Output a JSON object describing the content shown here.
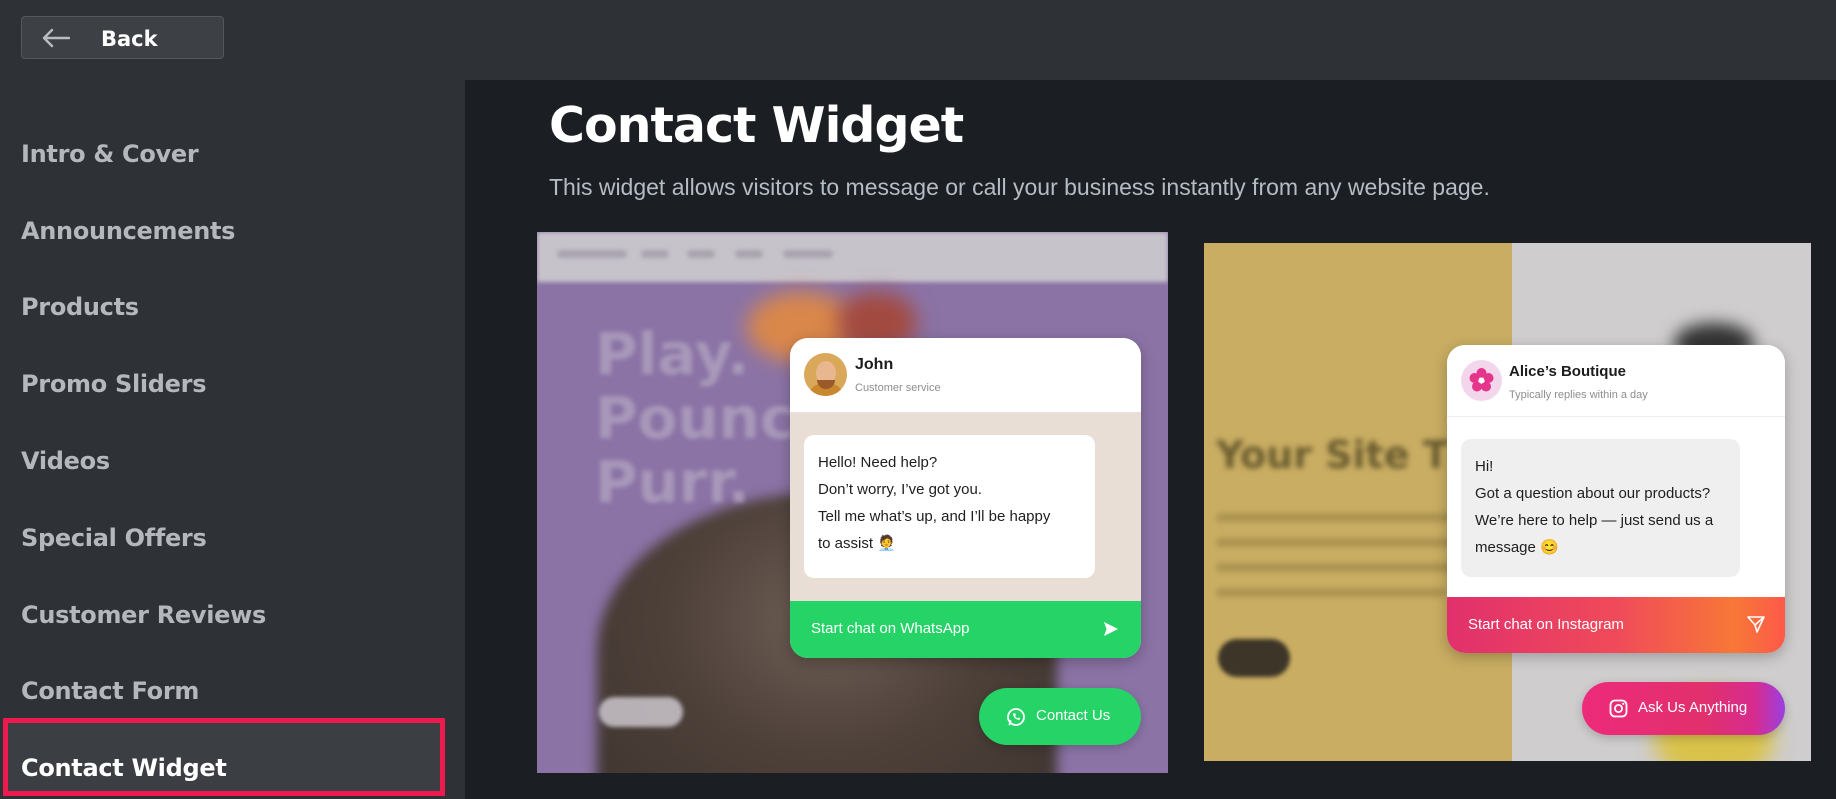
{
  "topbar": {
    "back_label": "Back"
  },
  "sidebar": {
    "items": [
      {
        "label": "Intro & Cover"
      },
      {
        "label": "Announcements"
      },
      {
        "label": "Products"
      },
      {
        "label": "Promo Sliders"
      },
      {
        "label": "Videos"
      },
      {
        "label": "Special Offers"
      },
      {
        "label": "Customer Reviews"
      },
      {
        "label": "Contact Form"
      },
      {
        "label": "Contact Widget",
        "active": true
      }
    ]
  },
  "main": {
    "title": "Contact Widget",
    "description": "This widget allows visitors to message or call your business instantly from any website page."
  },
  "preview_whatsapp": {
    "background_text": "Play.\nPounce.\nPurr.",
    "agent_name": "John",
    "agent_role": "Customer service",
    "message_lines": [
      "Hello! Need help?",
      "Don’t worry, I’ve got you.",
      "Tell me what’s up, and I’ll be happy",
      "to assist 🧑‍💼"
    ],
    "cta_label": "Start chat on WhatsApp",
    "fab_label": "Contact Us",
    "accent": "#25d366"
  },
  "preview_instagram": {
    "background_title": "Your Site Title",
    "agent_name": "Alice’s Boutique",
    "agent_role": "Typically replies within a day",
    "message_lines": [
      "Hi!",
      "Got a question about our products?",
      "We’re here to help — just send us a",
      "message 😊"
    ],
    "cta_label": "Start chat on Instagram",
    "fab_label": "Ask Us Anything",
    "accent": "#e1306c"
  },
  "colors": {
    "highlight": "#ee1a4f",
    "sidebar_bg": "#2e3236",
    "main_bg": "#1b1f23"
  }
}
